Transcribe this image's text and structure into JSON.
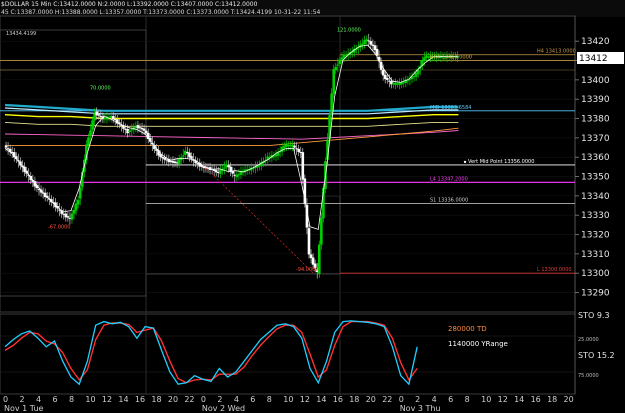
{
  "header": {
    "line1": "$DOLLAR 15 Min C:13412.0000 N:2.0000 L:13392.0000 C:13407.0000 C:13412.0000",
    "line2": "45 C:13387.0000 H:13388.0000 L:13357.0000 T:13373.0000 C:13373.0000 T:13424.4199 10-31-22 11:54"
  },
  "top_left_label": "13434.4199",
  "chart_data": {
    "type": "line",
    "ylim": [
      13282,
      13432
    ],
    "yticks": [
      13420,
      13410,
      13400,
      13390,
      13380,
      13370,
      13360,
      13350,
      13340,
      13330,
      13320,
      13310,
      13300,
      13290
    ],
    "last_price": 13412,
    "xticks": [
      "0",
      "2",
      "4",
      "6",
      "8",
      "10",
      "12",
      "14",
      "16",
      "18",
      "20",
      "22",
      "0",
      "2",
      "4",
      "6",
      "8",
      "10",
      "12",
      "14",
      "16",
      "18",
      "20",
      "22",
      "0",
      "2",
      "4",
      "6",
      "8",
      "10",
      "12",
      "14",
      "16",
      "18",
      "20"
    ],
    "day_labels": [
      {
        "label": "Nov 1 Tue",
        "index": 0
      },
      {
        "label": "Nov 2 Wed",
        "index": 12
      },
      {
        "label": "Nov 3 Thu",
        "index": 24
      }
    ],
    "price": {
      "x": [
        0,
        0.5,
        1,
        1.5,
        2,
        2.5,
        3,
        3.5,
        4,
        4.5,
        5,
        5.5,
        6,
        6.5,
        7,
        7.5,
        8,
        8.5,
        9,
        9.5,
        10,
        10.5,
        11,
        11.5,
        12,
        12.5,
        13,
        13.5,
        14,
        14.5,
        15,
        15.5,
        16,
        16.5,
        17,
        17.5,
        18,
        18.5,
        19,
        19.5,
        20,
        20.5,
        21,
        21.5,
        22,
        22.5,
        23,
        23.5,
        24,
        24.5,
        25,
        25.5,
        26,
        26.5,
        27,
        27.5
      ],
      "values": [
        13366,
        13362,
        13356,
        13350,
        13344,
        13340,
        13336,
        13331,
        13328,
        13338,
        13366,
        13383,
        13380,
        13381,
        13377,
        13373,
        13376,
        13374,
        13366,
        13360,
        13358,
        13357,
        13363,
        13358,
        13355,
        13354,
        13352,
        13356,
        13350,
        13353,
        13354,
        13356,
        13360,
        13361,
        13366,
        13366,
        13362,
        13310,
        13300,
        13358,
        13405,
        13412,
        13414,
        13417,
        13421,
        13416,
        13402,
        13398,
        13398,
        13400,
        13403,
        13412,
        13412,
        13412,
        13412,
        13412
      ]
    },
    "bands": {
      "x": [
        0,
        2,
        4,
        6,
        8,
        10,
        12,
        14,
        16,
        18,
        20,
        22,
        24,
        26,
        27.5
      ],
      "upper": [
        13387,
        13386,
        13385,
        13384,
        13384,
        13384,
        13384,
        13384,
        13384,
        13384,
        13384,
        13384,
        13385,
        13386,
        13386
      ],
      "mid": [
        13382,
        13381,
        13381,
        13380,
        13380,
        13380,
        13380,
        13380,
        13380,
        13380,
        13380,
        13380,
        13381,
        13382,
        13382
      ]
    },
    "annotations": [
      {
        "text": "RR4 13410.0000",
        "y": 13410,
        "color": "#d4b04a"
      },
      {
        "text": "H4 13413.0000",
        "y": 13413,
        "color": "#c89848"
      },
      {
        "text": "MID 13383.6584",
        "y": 13384,
        "color": "#5ac8ff"
      },
      {
        "text": "Vert Mid Point 13356.0000",
        "y": 13356,
        "color": "#ffffff"
      },
      {
        "text": "L4 13347.2000",
        "y": 13347,
        "color": "#ff3dff"
      },
      {
        "text": "S1 13336.0000",
        "y": 13336,
        "color": "#cfcfcf"
      },
      {
        "text": "L 13300.0000",
        "y": 13300,
        "color": "#e03a3a"
      },
      {
        "text": "121.0000",
        "y": 13424,
        "color": "#5cff5c"
      },
      {
        "text": "70.0000",
        "y": 13394,
        "color": "#5cff5c"
      },
      {
        "text": "-67.0000",
        "y": 13322,
        "color": "#ff5040"
      },
      {
        "text": "-94.0000",
        "y": 13300,
        "color": "#ff5040"
      }
    ]
  },
  "indicator": {
    "title1": "STO",
    "value1": "9.3",
    "title2": "STO",
    "value2": "15.2",
    "label_td": "280000 TD",
    "label_range": "1140000 YRange",
    "tick_top": "25.0000",
    "tick_bottom": "75.0000",
    "stoch_x": [
      0,
      0.5,
      1,
      1.5,
      2,
      2.5,
      3,
      3.5,
      4,
      4.5,
      5,
      5.5,
      6,
      6.5,
      7,
      7.5,
      8,
      8.5,
      9,
      9.5,
      10,
      10.5,
      11,
      11.5,
      12,
      12.5,
      13,
      13.5,
      14,
      14.5,
      15,
      15.5,
      16,
      16.5,
      17,
      17.5,
      18,
      18.5,
      19,
      19.5,
      20,
      20.5,
      21,
      21.5,
      22,
      22.5,
      23,
      23.5,
      24,
      24.5,
      25
    ],
    "k": [
      60,
      70,
      78,
      82,
      72,
      60,
      68,
      40,
      18,
      8,
      40,
      90,
      95,
      92,
      94,
      88,
      72,
      88,
      86,
      55,
      25,
      8,
      10,
      20,
      15,
      12,
      30,
      18,
      25,
      40,
      55,
      70,
      80,
      90,
      92,
      88,
      72,
      30,
      10,
      40,
      80,
      95,
      96,
      95,
      94,
      92,
      88,
      60,
      20,
      8,
      60
    ],
    "d": [
      55,
      62,
      72,
      80,
      78,
      68,
      64,
      52,
      30,
      14,
      28,
      70,
      90,
      93,
      93,
      91,
      80,
      83,
      86,
      68,
      40,
      16,
      10,
      14,
      15,
      14,
      22,
      22,
      22,
      32,
      48,
      62,
      74,
      85,
      90,
      90,
      80,
      50,
      18,
      28,
      62,
      88,
      95,
      95,
      95,
      93,
      90,
      72,
      38,
      14,
      30
    ]
  },
  "colors": {
    "up_candle": "#00d000",
    "down_candle": "#ffffff",
    "band_cyan": "#22aacc",
    "band_light": "#b8e8ff",
    "yellow_line": "#ffff00",
    "pink_line": "#ff66cc",
    "orange_line": "#ff9a40",
    "stoch_k": "#20d0ff",
    "stoch_d": "#ff3030"
  }
}
